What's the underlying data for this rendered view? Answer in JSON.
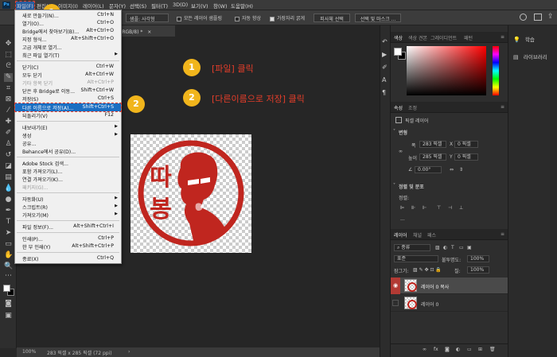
{
  "menubar": {
    "ps_logo": "Ps",
    "items": [
      "파일(F)",
      "편집(E)",
      "이미지(I)",
      "레이어(L)",
      "문자(Y)",
      "선택(S)",
      "필터(T)",
      "3D(D)",
      "보기(V)",
      "창(W)",
      "도움말(H)"
    ]
  },
  "options": {
    "sample_label": "샘플: 사각형",
    "all_layers": "모든 레이어 샘플링",
    "auto_enhance": "자동 향상",
    "hard_edge": "가장자리 굵게",
    "subject_button": "피사체 선택",
    "mask_button": "선택 및 마스크 ..."
  },
  "doc": {
    "tab_title": "사, RGB/8) *",
    "zoom": "100%",
    "info": "283 픽셀 x 285 픽셀 (72 ppi)"
  },
  "file_menu": [
    {
      "label": "새로 만들기(N)...",
      "shortcut": "Ctrl+N"
    },
    {
      "label": "열기(O)...",
      "shortcut": "Ctrl+O"
    },
    {
      "label": "Bridge에서 찾아보기(B)...",
      "shortcut": "Alt+Ctrl+O"
    },
    {
      "label": "지정 형식...",
      "shortcut": "Alt+Shift+Ctrl+O"
    },
    {
      "label": "고급 개체로 열기...",
      "shortcut": ""
    },
    {
      "label": "최근 파일 열기(T)",
      "shortcut": ""
    },
    {
      "label": "닫기(C)",
      "shortcut": "Ctrl+W"
    },
    {
      "label": "모두 닫기",
      "shortcut": "Alt+Ctrl+W"
    },
    {
      "label": "기타 항목 닫기",
      "shortcut": "Alt+Ctrl+P"
    },
    {
      "label": "닫은 후 Bridge로 이동...",
      "shortcut": "Shift+Ctrl+W"
    },
    {
      "label": "저장(S)",
      "shortcut": "Ctrl+S"
    },
    {
      "label": "다른 이름으로 저장(A)...",
      "shortcut": "Shift+Ctrl+S"
    },
    {
      "label": "되돌리기(V)",
      "shortcut": "F12"
    },
    {
      "label": "내보내기(E)",
      "shortcut": ""
    },
    {
      "label": "생성",
      "shortcut": ""
    },
    {
      "label": "공유...",
      "shortcut": ""
    },
    {
      "label": "Behance에서 공유(D)...",
      "shortcut": ""
    },
    {
      "label": "Adobe Stock 검색...",
      "shortcut": ""
    },
    {
      "label": "포함 가져오기(L)...",
      "shortcut": ""
    },
    {
      "label": "연결 가져오기(K)...",
      "shortcut": ""
    },
    {
      "label": "패키지(G)...",
      "shortcut": ""
    },
    {
      "label": "자동화(U)",
      "shortcut": ""
    },
    {
      "label": "스크립트(R)",
      "shortcut": ""
    },
    {
      "label": "가져오기(M)",
      "shortcut": ""
    },
    {
      "label": "파일 정보(F)...",
      "shortcut": "Alt+Shift+Ctrl+I"
    },
    {
      "label": "인쇄(P)...",
      "shortcut": "Ctrl+P"
    },
    {
      "label": "한 부 인쇄(Y)",
      "shortcut": "Alt+Shift+Ctrl+P"
    },
    {
      "label": "종료(X)",
      "shortcut": "Ctrl+Q"
    }
  ],
  "annotations": {
    "step1_num": "1",
    "step1_text": "[파일] 클릭",
    "step2_num": "2",
    "step2_text": "[다른이름으로 저장] 클릭"
  },
  "stamp": {
    "chars": [
      "따",
      "봉"
    ]
  },
  "color_panel": {
    "tabs": [
      "색상",
      "색상 견본",
      "그레이디언트",
      "패턴"
    ]
  },
  "properties_panel": {
    "tabs": [
      "속성",
      "조정"
    ],
    "kind": "픽셀 레이어",
    "transform_label": "변형",
    "w_label": "폭",
    "w_value": "283 픽셀",
    "x_label": "X",
    "x_value": "0 픽셀",
    "h_label": "높이",
    "h_value": "285 픽셀",
    "y_label": "Y",
    "y_value": "0 픽셀",
    "angle": "0.00°",
    "align_label": "정렬 및 분포",
    "align_sub": "정렬:"
  },
  "layers_panel": {
    "tabs": [
      "레이어",
      "채널",
      "패스"
    ],
    "kind_filter": "종류",
    "blend_mode": "표준",
    "opacity_label": "불투명도:",
    "opacity_value": "100%",
    "lock_label": "잠그기:",
    "fill_label": "칠:",
    "fill_value": "100%",
    "layers": [
      {
        "name": "레이어 0 복사",
        "selected": true
      },
      {
        "name": "레이어 0",
        "selected": false
      }
    ]
  },
  "far_right": {
    "learn": "학습",
    "libraries": "라이브러리"
  },
  "colors": {
    "accent_red": "#e53d2a",
    "badge": "#f1b51c",
    "highlight": "#1a6ec2",
    "stamp_red": "#c0261f"
  }
}
